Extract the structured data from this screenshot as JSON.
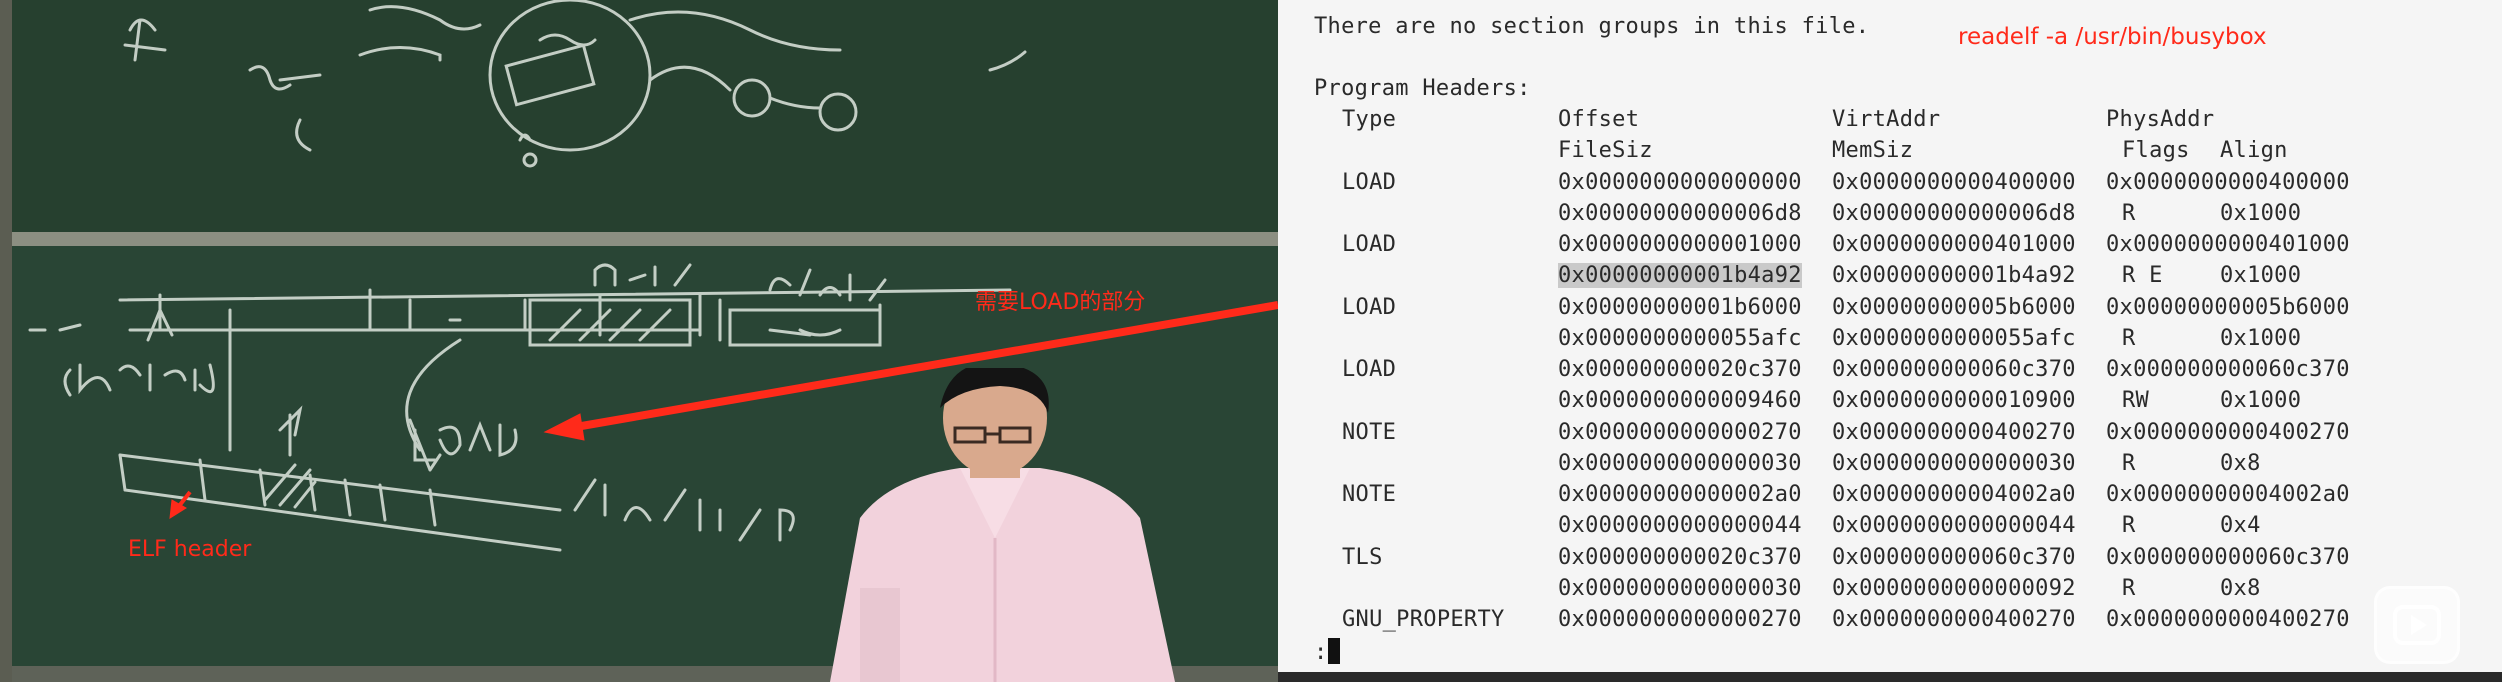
{
  "annotations": {
    "need_load": "需要LOAD的部分",
    "elf_header": "ELF header",
    "command": "readelf -a /usr/bin/busybox"
  },
  "terminal": {
    "no_groups": "There are no section groups in this file.",
    "program_headers_title": "Program Headers:",
    "col_type": "Type",
    "col_offset": "Offset",
    "col_virtaddr": "VirtAddr",
    "col_physaddr": "PhysAddr",
    "col_filesiz": "FileSiz",
    "col_memsiz": "MemSiz",
    "col_flags": "Flags",
    "col_align": "Align",
    "rows": [
      {
        "type": "LOAD",
        "offset": "0x0000000000000000",
        "virt": "0x0000000000400000",
        "phys": "0x0000000000400000",
        "filesiz": "0x00000000000006d8",
        "memsiz": "0x00000000000006d8",
        "flags": "R",
        "align": "0x1000"
      },
      {
        "type": "LOAD",
        "offset": "0x0000000000001000",
        "virt": "0x0000000000401000",
        "phys": "0x0000000000401000",
        "filesiz": "0x00000000001b4a92",
        "memsiz": "0x00000000001b4a92",
        "flags": "R E",
        "align": "0x1000"
      },
      {
        "type": "LOAD",
        "offset": "0x00000000001b6000",
        "virt": "0x00000000005b6000",
        "phys": "0x00000000005b6000",
        "filesiz": "0x0000000000055afc",
        "memsiz": "0x0000000000055afc",
        "flags": "R",
        "align": "0x1000"
      },
      {
        "type": "LOAD",
        "offset": "0x000000000020c370",
        "virt": "0x000000000060c370",
        "phys": "0x000000000060c370",
        "filesiz": "0x0000000000009460",
        "memsiz": "0x0000000000010900",
        "flags": "RW",
        "align": "0x1000"
      },
      {
        "type": "NOTE",
        "offset": "0x0000000000000270",
        "virt": "0x0000000000400270",
        "phys": "0x0000000000400270",
        "filesiz": "0x0000000000000030",
        "memsiz": "0x0000000000000030",
        "flags": "R",
        "align": "0x8"
      },
      {
        "type": "NOTE",
        "offset": "0x00000000000002a0",
        "virt": "0x00000000004002a0",
        "phys": "0x00000000004002a0",
        "filesiz": "0x0000000000000044",
        "memsiz": "0x0000000000000044",
        "flags": "R",
        "align": "0x4"
      },
      {
        "type": "TLS",
        "offset": "0x000000000020c370",
        "virt": "0x000000000060c370",
        "phys": "0x000000000060c370",
        "filesiz": "0x0000000000000030",
        "memsiz": "0x0000000000000092",
        "flags": "R",
        "align": "0x8"
      },
      {
        "type": "GNU_PROPERTY",
        "offset": "0x0000000000000270",
        "virt": "0x0000000000400270",
        "phys": "0x0000000000400270"
      }
    ],
    "prompt": ":"
  },
  "colors": {
    "annotation": "#ff2a1a",
    "terminal_bg": "#f5f5f5",
    "chalkboard": "#294535"
  },
  "icons": {
    "play": "play-icon"
  }
}
